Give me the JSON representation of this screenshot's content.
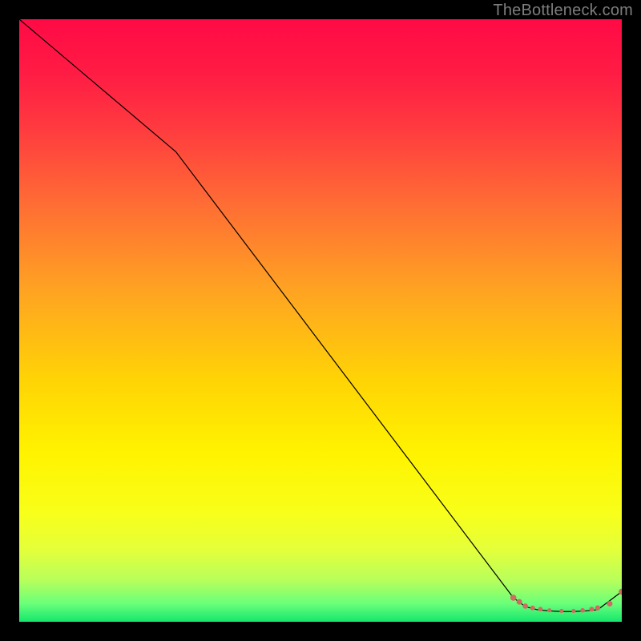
{
  "watermark": "TheBottleneck.com",
  "chart_data": {
    "type": "line",
    "title": "",
    "xlabel": "",
    "ylabel": "",
    "xlim": [
      0,
      100
    ],
    "ylim": [
      0,
      100
    ],
    "grid": false,
    "legend": false,
    "series": [
      {
        "name": "curve",
        "stroke": "#000000",
        "stroke_width": 1.2,
        "fill": "none",
        "x": [
          0,
          26,
          82,
          84,
          86,
          88,
          90,
          92,
          94,
          96,
          100
        ],
        "y": [
          100,
          78,
          4,
          2.5,
          2,
          1.8,
          1.7,
          1.7,
          1.8,
          2,
          5
        ]
      },
      {
        "name": "markers",
        "stroke": "none",
        "marker_fill": "#d16a62",
        "marker_radius_base": 3.0,
        "x": [
          82,
          83,
          84,
          85.2,
          86.5,
          88,
          90,
          92,
          93.5,
          95,
          96,
          98,
          100
        ],
        "y": [
          4,
          3.3,
          2.6,
          2.3,
          2.1,
          1.9,
          1.8,
          1.8,
          1.9,
          2.1,
          2.3,
          3,
          5
        ],
        "r": [
          3.8,
          3.5,
          3.3,
          3.0,
          2.8,
          2.6,
          2.6,
          2.6,
          2.8,
          3.0,
          3.2,
          3.5,
          3.8
        ]
      }
    ],
    "background_gradient": {
      "stops": [
        {
          "offset": 0.0,
          "color": "#ff0a45"
        },
        {
          "offset": 0.09,
          "color": "#ff1c44"
        },
        {
          "offset": 0.18,
          "color": "#ff3a3f"
        },
        {
          "offset": 0.3,
          "color": "#ff6a35"
        },
        {
          "offset": 0.45,
          "color": "#ffa322"
        },
        {
          "offset": 0.6,
          "color": "#ffd405"
        },
        {
          "offset": 0.72,
          "color": "#fff300"
        },
        {
          "offset": 0.82,
          "color": "#f8ff1a"
        },
        {
          "offset": 0.88,
          "color": "#e4ff3a"
        },
        {
          "offset": 0.93,
          "color": "#b9ff5a"
        },
        {
          "offset": 0.97,
          "color": "#6aff7a"
        },
        {
          "offset": 1.0,
          "color": "#15e76d"
        }
      ]
    }
  }
}
